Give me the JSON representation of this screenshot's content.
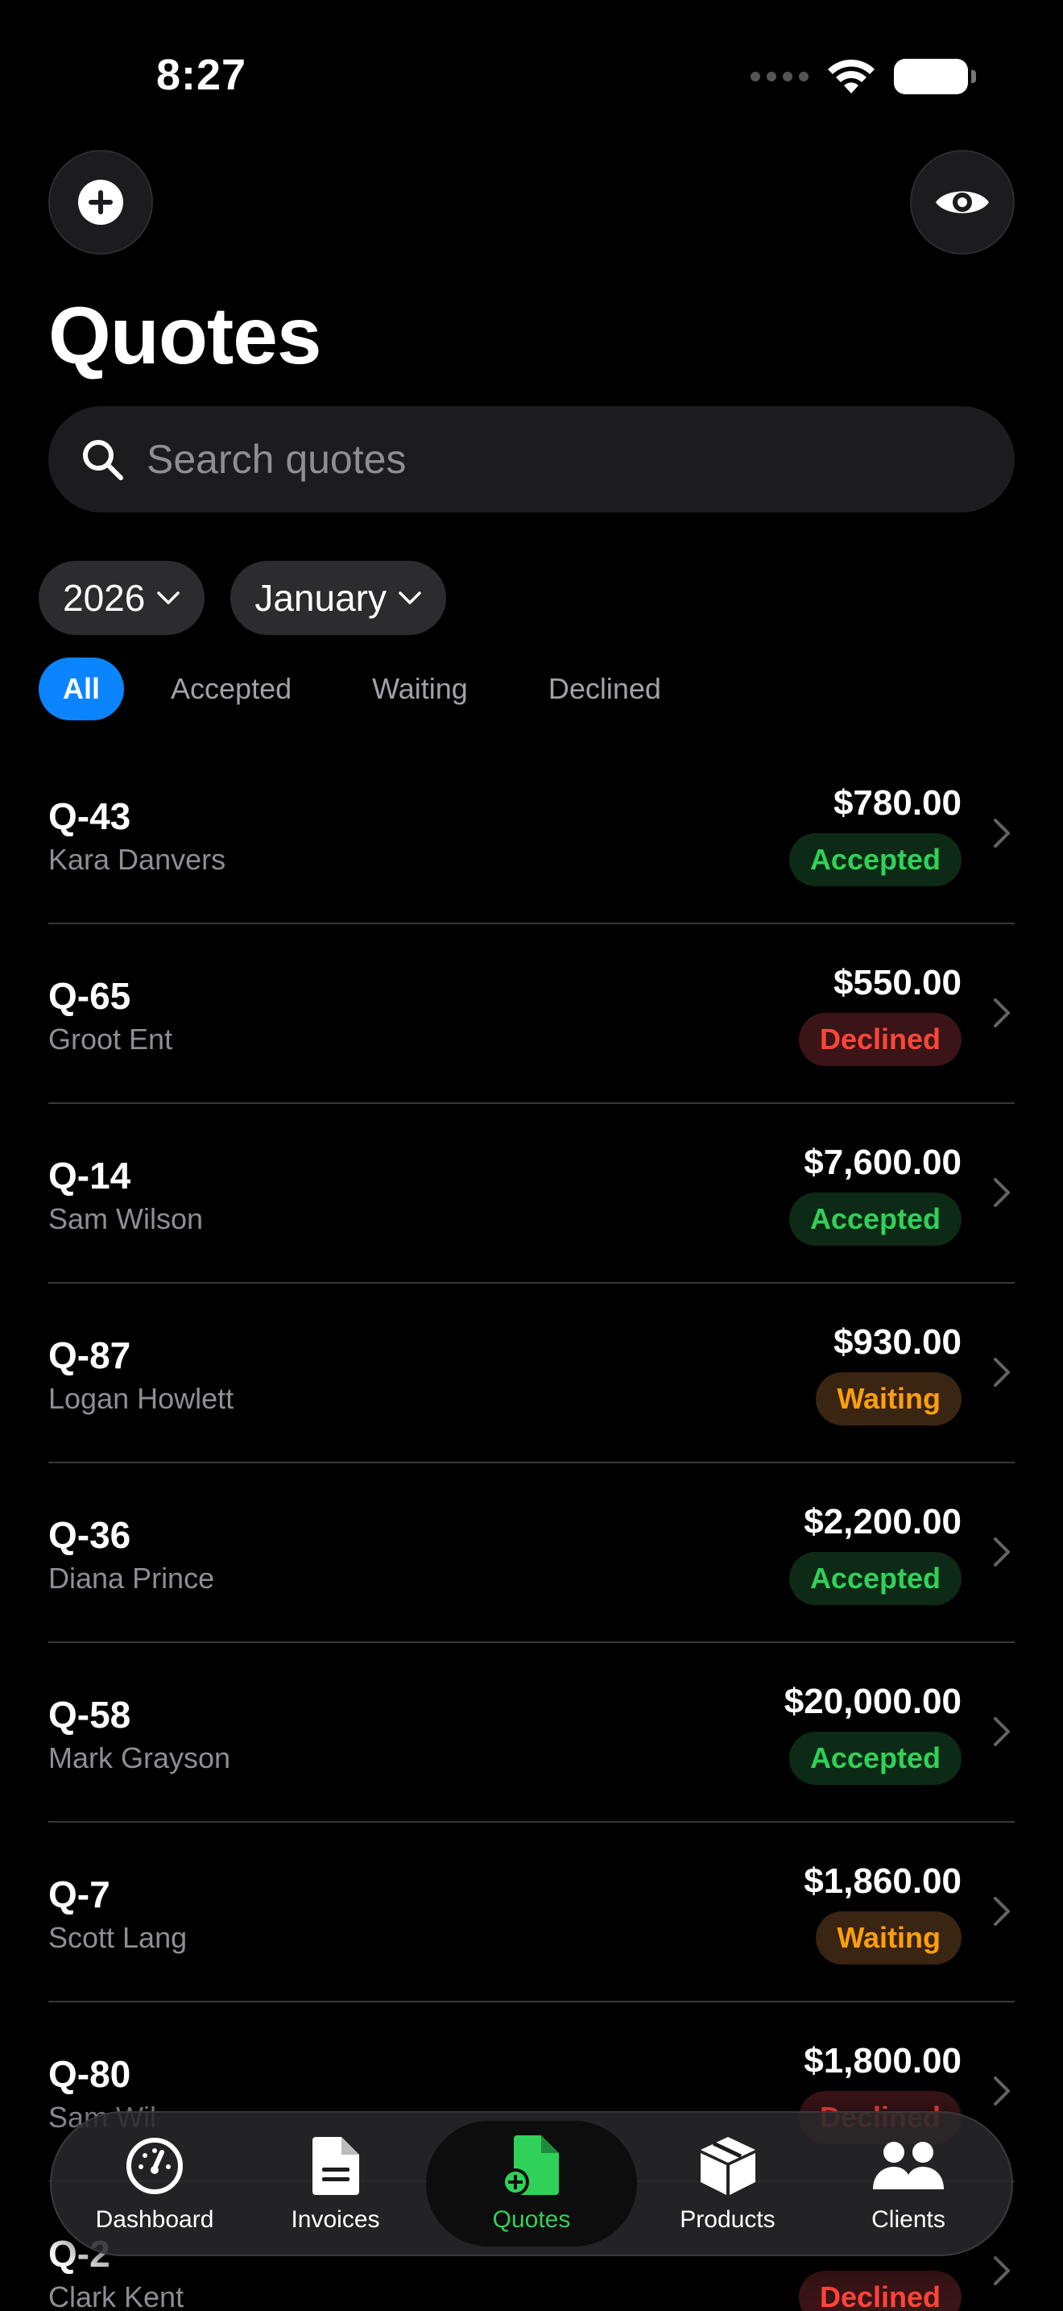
{
  "status": {
    "time": "8:27"
  },
  "title": "Quotes",
  "search": {
    "placeholder": "Search quotes",
    "value": ""
  },
  "filters": {
    "year": "2026",
    "month": "January"
  },
  "segments": [
    {
      "label": "All",
      "active": true
    },
    {
      "label": "Accepted",
      "active": false
    },
    {
      "label": "Waiting",
      "active": false
    },
    {
      "label": "Declined",
      "active": false
    }
  ],
  "quotes": [
    {
      "id": "Q-43",
      "client": "Kara Danvers",
      "amount": "$780.00",
      "status": "Accepted"
    },
    {
      "id": "Q-65",
      "client": "Groot Ent",
      "amount": "$550.00",
      "status": "Declined"
    },
    {
      "id": "Q-14",
      "client": "Sam Wilson",
      "amount": "$7,600.00",
      "status": "Accepted"
    },
    {
      "id": "Q-87",
      "client": "Logan Howlett",
      "amount": "$930.00",
      "status": "Waiting"
    },
    {
      "id": "Q-36",
      "client": "Diana Prince",
      "amount": "$2,200.00",
      "status": "Accepted"
    },
    {
      "id": "Q-58",
      "client": "Mark Grayson",
      "amount": "$20,000.00",
      "status": "Accepted"
    },
    {
      "id": "Q-7",
      "client": "Scott Lang",
      "amount": "$1,860.00",
      "status": "Waiting"
    },
    {
      "id": "Q-80",
      "client": "Sam Wil",
      "amount": "$1,800.00",
      "status": "Declined"
    },
    {
      "id": "Q-2",
      "client": "Clark Kent",
      "amount": "",
      "status": "Declined"
    }
  ],
  "tabs": [
    {
      "label": "Dashboard",
      "icon": "gauge-icon",
      "active": false
    },
    {
      "label": "Invoices",
      "icon": "document-icon",
      "active": false
    },
    {
      "label": "Quotes",
      "icon": "document-plus-icon",
      "active": true
    },
    {
      "label": "Products",
      "icon": "box-icon",
      "active": false
    },
    {
      "label": "Clients",
      "icon": "people-icon",
      "active": false
    }
  ],
  "colors": {
    "accent": "#0a84ff",
    "accepted": "#30d158",
    "declined": "#ff453a",
    "waiting": "#ff9f0a",
    "background": "#000000"
  }
}
